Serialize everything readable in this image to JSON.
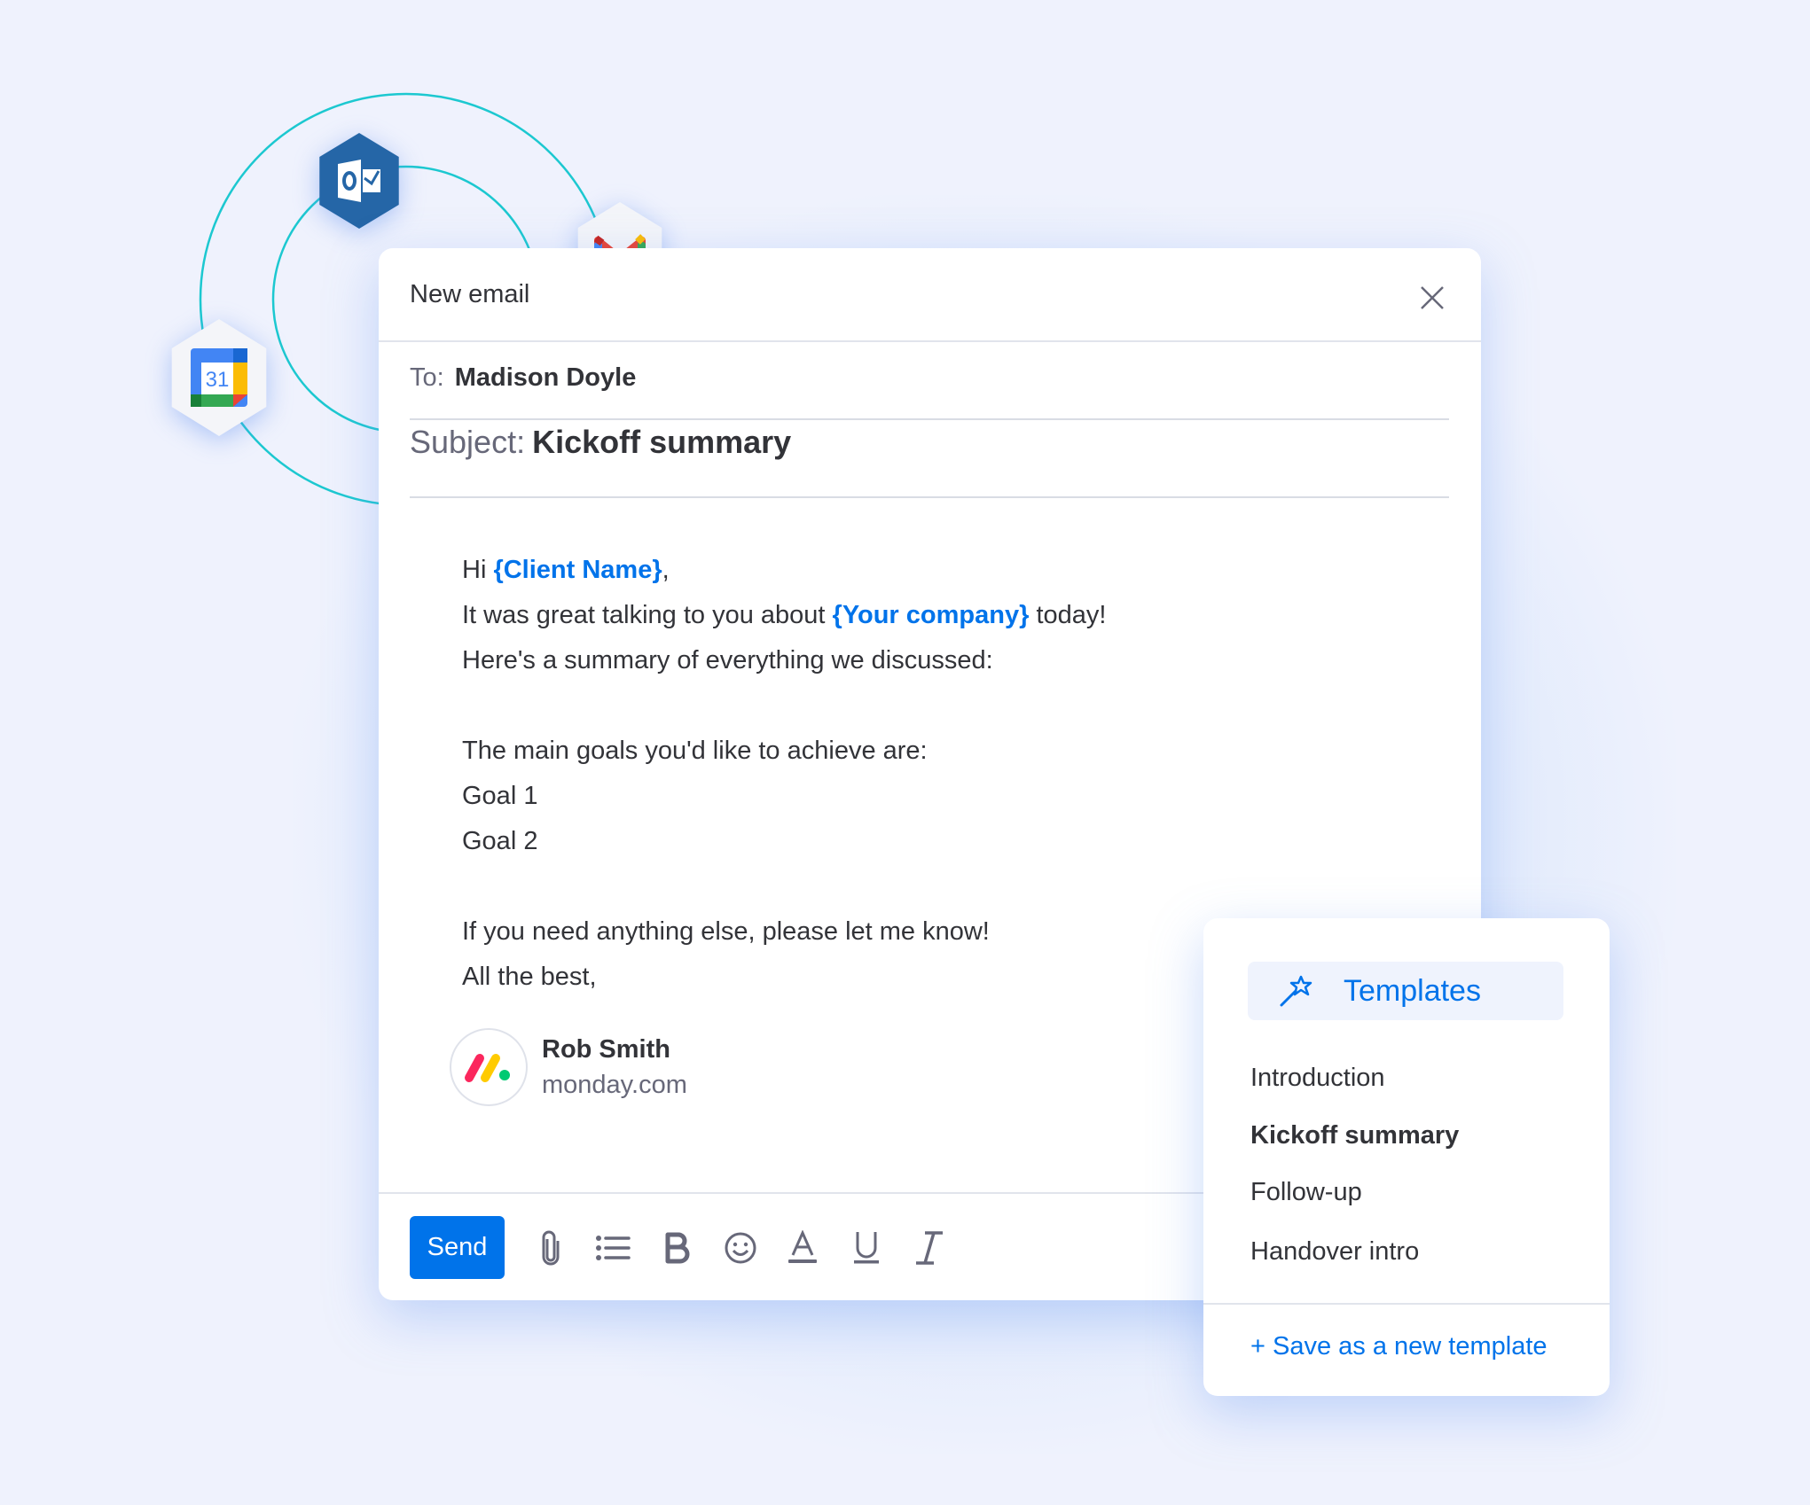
{
  "integrations": [
    {
      "name": "Outlook",
      "icon": "outlook-icon"
    },
    {
      "name": "Gmail",
      "icon": "gmail-icon"
    },
    {
      "name": "Google Calendar",
      "icon": "google-calendar-icon",
      "label": "31"
    }
  ],
  "email": {
    "title": "New email",
    "to_label": "To:",
    "to_value": "Madison Doyle",
    "subject_label": "Subject:",
    "subject_value": "Kickoff summary",
    "body": {
      "line1": [
        "Hi ",
        "{Client Name}",
        ","
      ],
      "line2": [
        "It was great talking to you about ",
        "{Your company}",
        " today!"
      ],
      "line3": "Here's a summary of everything we discussed:",
      "line4": "The main goals you'd like to achieve are:",
      "line5": "Goal 1",
      "line6": "Goal 2",
      "line7": "If you need anything else, please let me know!",
      "line8": "All the best,"
    },
    "signature": {
      "name": "Rob Smith",
      "domain": "monday.com"
    },
    "send_label": "Send",
    "toolbar": [
      "attach-icon",
      "bulleted-list-icon",
      "bold-icon",
      "emoji-icon",
      "text-color-icon",
      "underline-icon",
      "italic-icon"
    ]
  },
  "templates": {
    "button_label": "Templates",
    "items": [
      {
        "label": "Introduction"
      },
      {
        "label": "Kickoff summary",
        "selected": true
      },
      {
        "label": "Follow-up"
      },
      {
        "label": "Handover intro"
      }
    ],
    "save_label": "+ Save as a new template"
  },
  "colors": {
    "accent": "#0073ea",
    "text": "#323338",
    "muted": "#676879",
    "arc": "#1cc8d0"
  }
}
